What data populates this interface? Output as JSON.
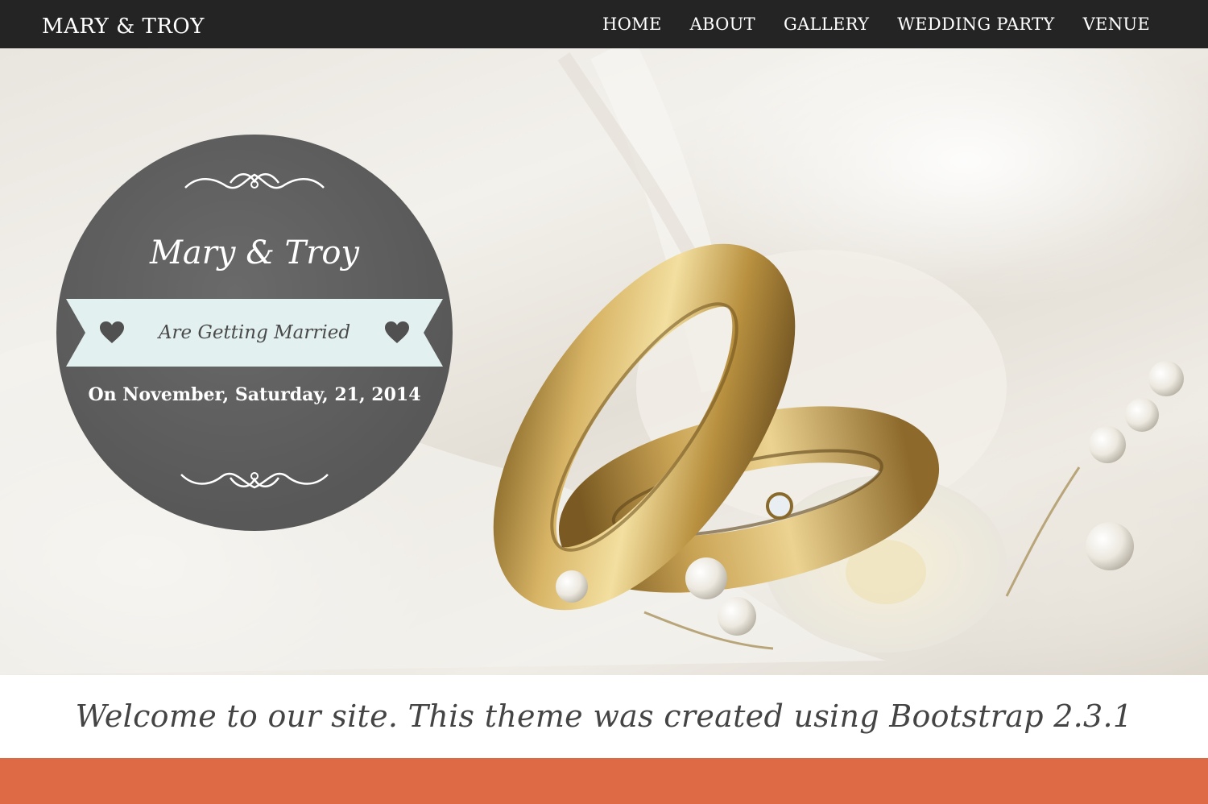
{
  "navbar": {
    "brand": "MARY & TROY",
    "items": [
      {
        "label": "HOME"
      },
      {
        "label": "ABOUT"
      },
      {
        "label": "GALLERY"
      },
      {
        "label": "WEDDING PARTY"
      },
      {
        "label": "VENUE"
      }
    ]
  },
  "hero": {
    "couple": "Mary & Troy",
    "ribbon_text": "Are Getting Married",
    "date": "On November, Saturday, 21, 2014",
    "icons": [
      "flourish-top-icon",
      "heart-icon",
      "heart-icon",
      "flourish-bottom-icon"
    ]
  },
  "welcome": {
    "text": "Welcome to our site. This theme was created using Bootstrap 2.3.1"
  },
  "colors": {
    "navbar_bg": "#242424",
    "badge_bg": "#5c5c5c",
    "ribbon_bg": "#e2f0ef",
    "accent_band": "#dd6a44",
    "welcome_text": "#444444"
  }
}
